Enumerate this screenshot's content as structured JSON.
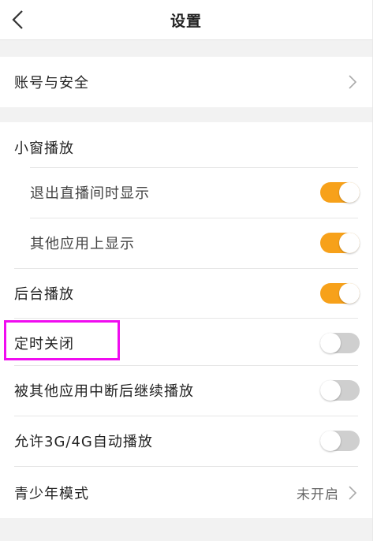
{
  "header": {
    "title": "设置"
  },
  "account": {
    "label": "账号与安全"
  },
  "pip": {
    "heading": "小窗播放",
    "items": [
      {
        "label": "退出直播间时显示",
        "toggle": "on"
      },
      {
        "label": "其他应用上显示",
        "toggle": "on"
      }
    ]
  },
  "settings": [
    {
      "label": "后台播放",
      "toggle": "on"
    },
    {
      "label": "定时关闭",
      "toggle": "off"
    },
    {
      "label": "被其他应用中断后继续播放",
      "toggle": "off"
    },
    {
      "label": "允许3G/4G自动播放",
      "toggle": "off"
    }
  ],
  "teen": {
    "label": "青少年模式",
    "value": "未开启"
  },
  "colors": {
    "accent": "#f7a11a",
    "toggle_off": "#cfcfcf",
    "highlight": "#f00cf0"
  },
  "icons": {
    "back": "back-arrow-icon",
    "chevron": "chevron-right-icon"
  }
}
